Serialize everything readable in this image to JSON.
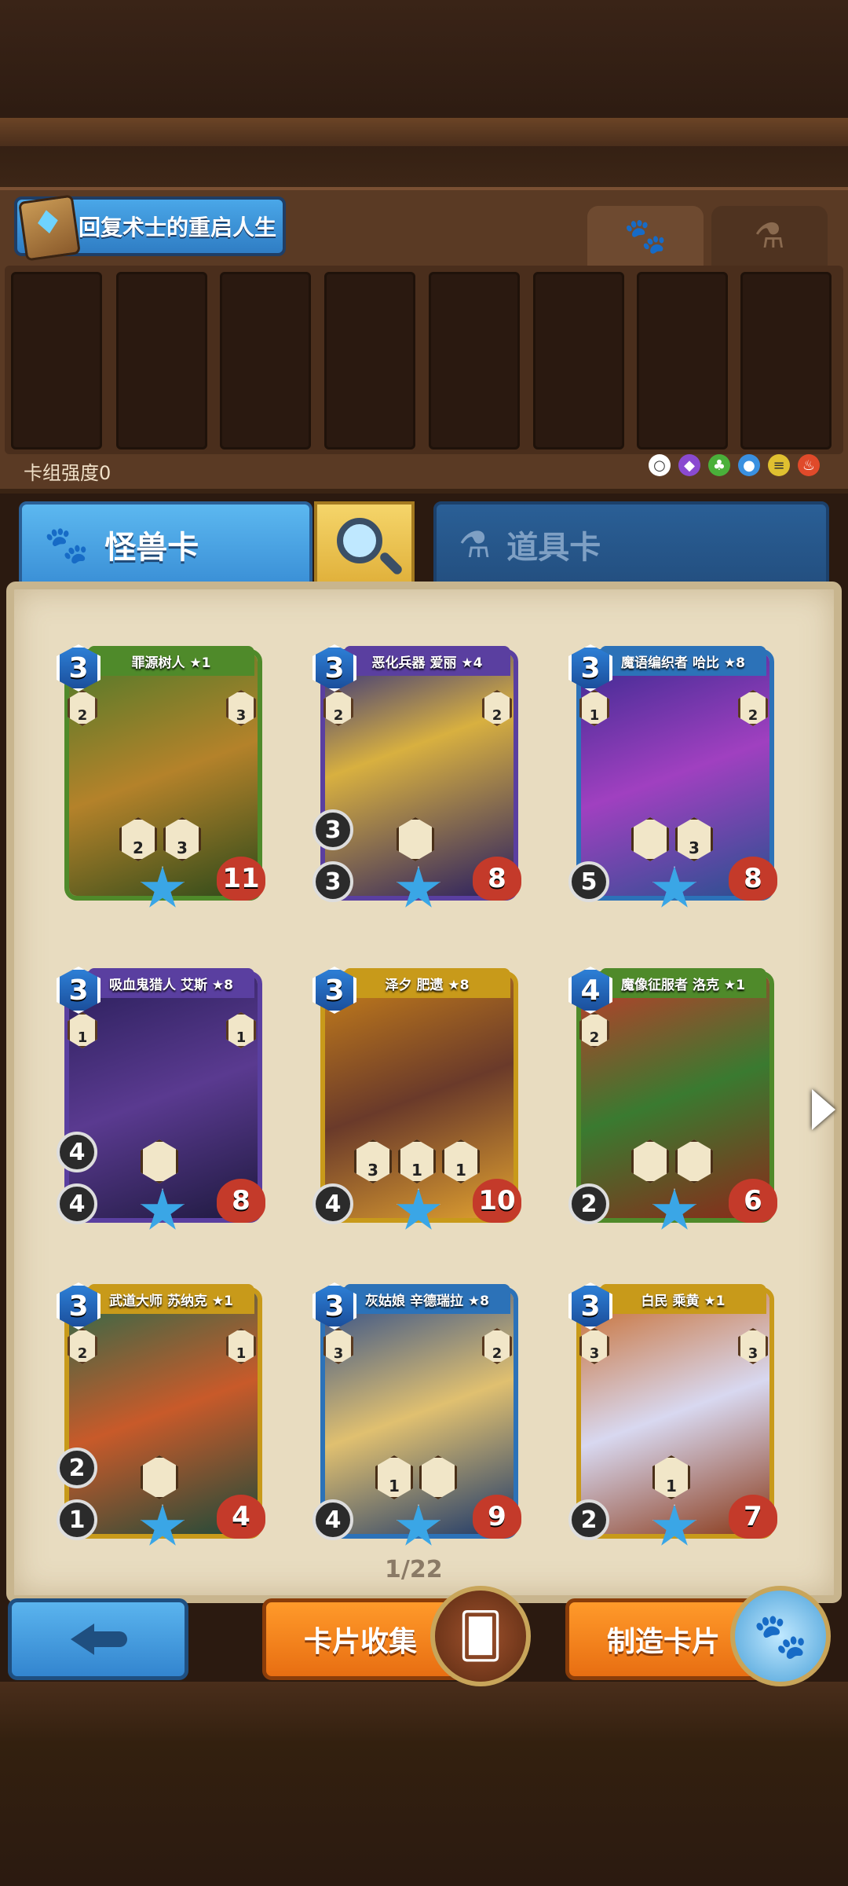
{
  "deck": {
    "name": "回复术士的重启人生",
    "strength_label": "卡组强度0",
    "slots": 8,
    "elements": [
      "○",
      "◆",
      "♣",
      "●",
      "≡",
      "♨"
    ]
  },
  "tabs": {
    "beast_label": "怪兽卡",
    "item_label": "道具卡"
  },
  "cards": [
    {
      "name": "罪源树人 ★1",
      "cost": "3",
      "hp": "11",
      "atk": "",
      "atk2": "",
      "skill_l": "2",
      "skill_r": "3",
      "abilities": [
        "2",
        "3"
      ],
      "frame": "#4f8a2a",
      "art": "linear-gradient(160deg,#4d7a2a,#b4822a 50%,#2f4a1a)"
    },
    {
      "name": "恶化兵器 爱丽 ★4",
      "cost": "3",
      "hp": "8",
      "atk": "3",
      "atk2": "3",
      "skill_l": "2",
      "skill_r": "2",
      "abilities": [
        ""
      ],
      "frame": "#5a3fa0",
      "art": "linear-gradient(160deg,#2a2a80,#d8b040 40%,#2a1f60)"
    },
    {
      "name": "魔语编织者 哈比 ★8",
      "cost": "3",
      "hp": "8",
      "atk": "5",
      "atk2": "",
      "skill_l": "1",
      "skill_r": "2",
      "abilities": [
        "",
        "3"
      ],
      "frame": "#2c72b8",
      "art": "linear-gradient(160deg,#3a2a90,#a040c0 50%,#2a5090)"
    },
    {
      "name": "吸血鬼猎人 艾斯 ★8",
      "cost": "3",
      "hp": "8",
      "atk": "4",
      "atk2": "4",
      "skill_l": "1",
      "skill_r": "1",
      "abilities": [
        ""
      ],
      "frame": "#5a3fa0",
      "art": "linear-gradient(160deg,#2a1f5a,#5a3a90 50%,#1f1a40)"
    },
    {
      "name": "泽夕 肥遗 ★8",
      "cost": "3",
      "hp": "10",
      "atk": "4",
      "atk2": "",
      "skill_l": "",
      "skill_r": "",
      "abilities": [
        "3",
        "1",
        "1"
      ],
      "frame": "#c89a1a",
      "art": "linear-gradient(160deg,#c8801a,#6a3a2a 50%,#e0a030)"
    },
    {
      "name": "魔像征服者 洛克 ★1",
      "cost": "4",
      "hp": "6",
      "atk": "2",
      "atk2": "",
      "skill_l": "2",
      "skill_r": "",
      "abilities": [
        "",
        ""
      ],
      "frame": "#4f8a2a",
      "art": "linear-gradient(160deg,#c03a2a,#3a7a30 50%,#8a2a1a)"
    },
    {
      "name": "武道大师 苏纳克 ★1",
      "cost": "3",
      "hp": "4",
      "atk": "1",
      "atk2": "2",
      "skill_l": "2",
      "skill_r": "1",
      "abilities": [
        ""
      ],
      "frame": "#c89a1a",
      "art": "linear-gradient(160deg,#2a6a4a,#c85a2a 50%,#1f4a3a)"
    },
    {
      "name": "灰姑娘 辛德瑞拉 ★8",
      "cost": "3",
      "hp": "9",
      "atk": "4",
      "atk2": "",
      "skill_l": "3",
      "skill_r": "2",
      "abilities": [
        "1",
        ""
      ],
      "frame": "#2c72b8",
      "art": "linear-gradient(160deg,#2a4a8a,#e0c070 50%,#1f3a6a)"
    },
    {
      "name": "白民 乘黄 ★1",
      "cost": "3",
      "hp": "7",
      "atk": "2",
      "atk2": "",
      "skill_l": "3",
      "skill_r": "3",
      "abilities": [
        "1"
      ],
      "frame": "#c89a1a",
      "art": "linear-gradient(160deg,#c86a2a,#d8d8f0 50%,#8a3a1a)"
    }
  ],
  "pagination": {
    "label": "1/22"
  },
  "buttons": {
    "collect_label": "卡片收集",
    "craft_label": "制造卡片"
  }
}
